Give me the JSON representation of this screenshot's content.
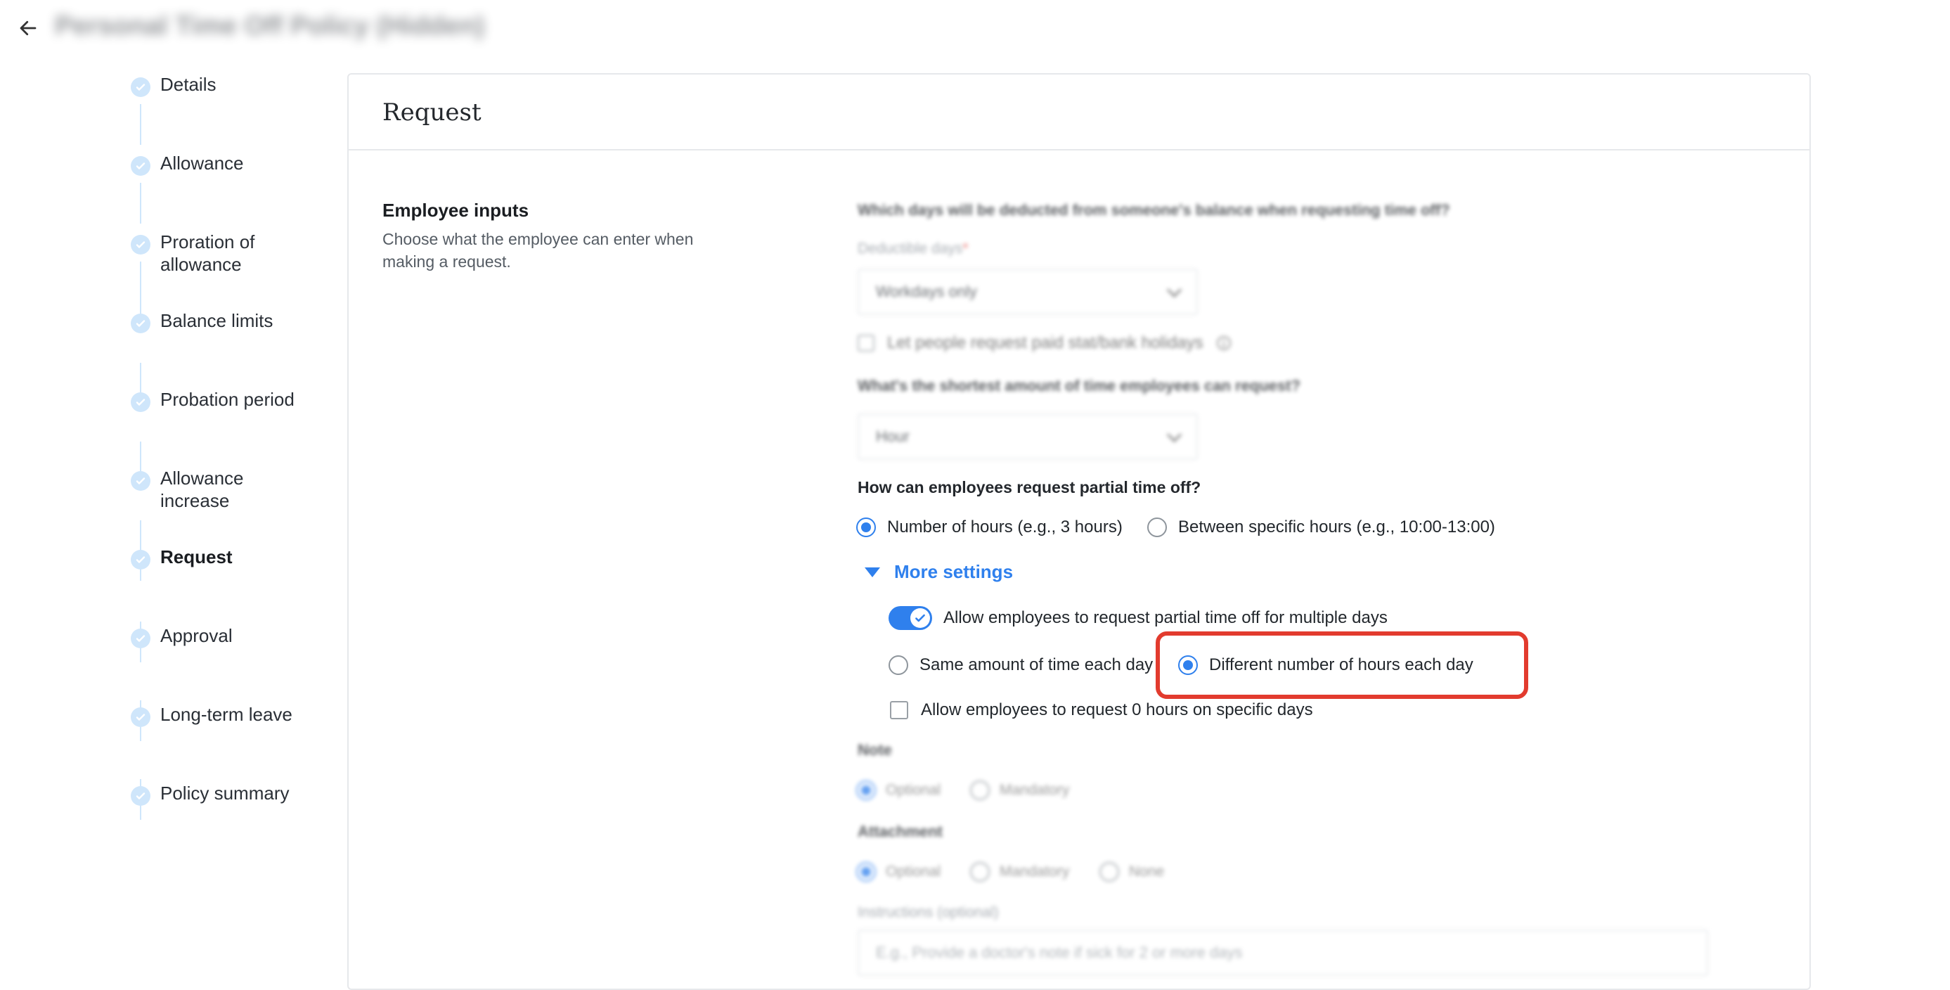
{
  "header": {
    "page_title": "Personal Time Off Policy (Hidden)"
  },
  "steps": [
    {
      "label": "Details"
    },
    {
      "label": "Allowance"
    },
    {
      "label": "Proration of allowance"
    },
    {
      "label": "Balance limits"
    },
    {
      "label": "Probation period"
    },
    {
      "label": "Allowance increase"
    },
    {
      "label": "Request"
    },
    {
      "label": "Approval"
    },
    {
      "label": "Long-term leave"
    },
    {
      "label": "Policy summary"
    }
  ],
  "card": {
    "title": "Request"
  },
  "section": {
    "title": "Employee inputs",
    "description": "Choose what the employee can enter when making a request."
  },
  "deductible": {
    "question": "Which days will be deducted from someone's balance when requesting time off?",
    "label": "Deductible days",
    "required_mark": "*",
    "value": "Workdays only",
    "holiday_checkbox": "Let people request paid stat/bank holidays"
  },
  "shortest": {
    "question": "What's the shortest amount of time employees can request?",
    "value": "Hour"
  },
  "partial": {
    "question": "How can employees request partial time off?",
    "option_hours": "Number of hours (e.g., 3 hours)",
    "option_between": "Between specific hours (e.g., 10:00-13:00)",
    "selected": "option_hours"
  },
  "more_settings": {
    "label": "More settings",
    "toggle_label": "Allow employees to request partial time off for multiple days",
    "toggle_on": true,
    "option_same": "Same amount of time each day",
    "option_different": "Different number of hours each day",
    "selected": "option_different",
    "zero_hours_label": "Allow employees to request 0 hours on specific days",
    "zero_hours_checked": false
  },
  "note": {
    "label": "Note",
    "option_optional": "Optional",
    "option_mandatory": "Mandatory",
    "selected": "option_optional"
  },
  "attachment": {
    "label": "Attachment",
    "option_optional": "Optional",
    "option_mandatory": "Mandatory",
    "option_none": "None",
    "selected": "option_optional"
  },
  "instructions": {
    "label": "Instructions (optional)",
    "placeholder": "E.g., Provide a doctor's note if sick for 2 or more days"
  },
  "colors": {
    "accent": "#2f80ed",
    "highlight": "#e23b2e",
    "step_done": "#cfe6fb"
  }
}
